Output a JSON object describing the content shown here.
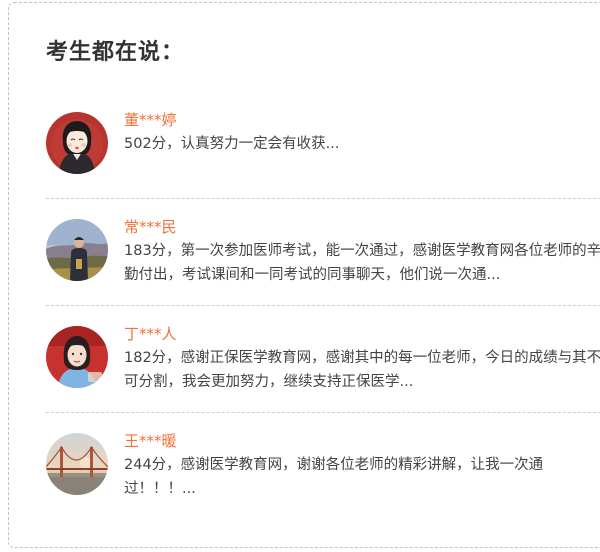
{
  "title": "考生都在说：",
  "testimonials": [
    {
      "name": "董***婷",
      "message": "502分，认真努力一定会有收获...",
      "avatar_icon": "cartoon-girl-avatar"
    },
    {
      "name": "常***民",
      "message": "183分，第一次参加医师考试，能一次通过，感谢医学教育网各位老师的辛勤付出，考试课间和一同考试的同事聊天，他们说一次通...",
      "avatar_icon": "man-outdoors-photo"
    },
    {
      "name": "丁***人",
      "message": "182分，感谢正保医学教育网，感谢其中的每一位老师，今日的成绩与其不可分割，我会更加努力，继续支持正保医学...",
      "avatar_icon": "woman-portrait-photo"
    },
    {
      "name": "王***暖",
      "message": "244分，感谢医学教育网，谢谢各位老师的精彩讲解，让我一次通过！！！...",
      "avatar_icon": "bridge-sunset-photo"
    }
  ],
  "colors": {
    "name": "#f0713c",
    "border": "#a9c6e2",
    "divider": "#c9cfd6"
  }
}
